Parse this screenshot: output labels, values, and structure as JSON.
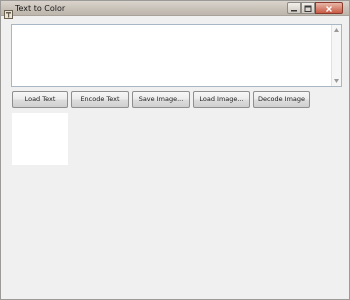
{
  "window": {
    "title": "Text to Color",
    "icon": "app-icon"
  },
  "titlebar_controls": [
    {
      "name": "minimize-icon"
    },
    {
      "name": "maximize-icon"
    },
    {
      "name": "close-icon"
    }
  ],
  "textarea": {
    "value": ""
  },
  "buttons": {
    "load_text": "Load Text",
    "encode_text": "Encode Text",
    "save_image": "Save Image...",
    "load_image": "Load Image...",
    "decode_image": "Decode Image"
  },
  "colors": {
    "window_bg": "#f0f0f0",
    "image_bg": "#ffffff"
  }
}
